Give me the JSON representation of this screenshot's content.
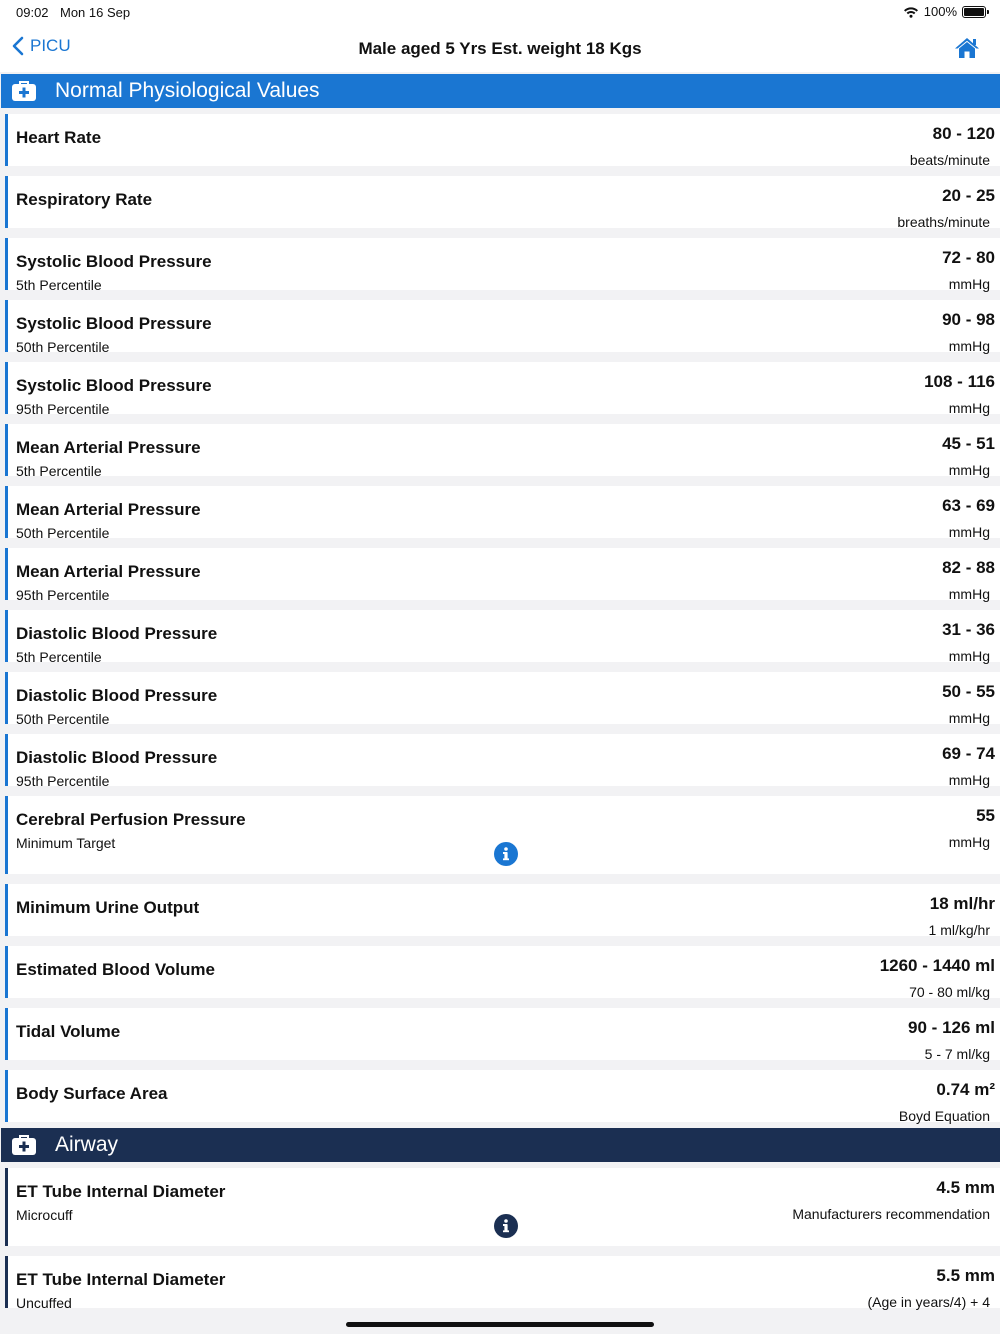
{
  "status": {
    "time": "09:02",
    "date": "Mon 16 Sep",
    "battery": "100%"
  },
  "nav": {
    "back_label": "PICU",
    "title": "Male aged 5 Yrs  Est. weight 18 Kgs"
  },
  "colors": {
    "accent": "#1a76d2",
    "airway_header": "#1b2f52"
  },
  "sections": [
    {
      "title": "Normal Physiological Values"
    },
    {
      "title": "Airway"
    }
  ],
  "rows": [
    {
      "name": "Heart Rate",
      "sub": "",
      "value": "80 - 120",
      "unit": "beats/minute"
    },
    {
      "name": "Respiratory Rate",
      "sub": "",
      "value": "20 - 25",
      "unit": "breaths/minute"
    },
    {
      "name": "Systolic Blood Pressure",
      "sub": "5th Percentile",
      "value": "72 - 80",
      "unit": "mmHg"
    },
    {
      "name": "Systolic Blood Pressure",
      "sub": "50th Percentile",
      "value": "90 - 98",
      "unit": "mmHg"
    },
    {
      "name": "Systolic Blood Pressure",
      "sub": "95th Percentile",
      "value": "108 - 116",
      "unit": "mmHg"
    },
    {
      "name": "Mean Arterial Pressure",
      "sub": "5th Percentile",
      "value": "45 - 51",
      "unit": "mmHg"
    },
    {
      "name": "Mean Arterial Pressure",
      "sub": "50th Percentile",
      "value": "63 - 69",
      "unit": "mmHg"
    },
    {
      "name": "Mean Arterial Pressure",
      "sub": "95th Percentile",
      "value": "82 - 88",
      "unit": "mmHg"
    },
    {
      "name": "Diastolic Blood Pressure",
      "sub": "5th Percentile",
      "value": "31 - 36",
      "unit": "mmHg"
    },
    {
      "name": "Diastolic Blood Pressure",
      "sub": "50th Percentile",
      "value": "50 - 55",
      "unit": "mmHg"
    },
    {
      "name": "Diastolic Blood Pressure",
      "sub": "95th Percentile",
      "value": "69 - 74",
      "unit": "mmHg"
    },
    {
      "name": "Cerebral Perfusion Pressure",
      "sub": "Minimum Target",
      "value": "55",
      "unit": "mmHg"
    },
    {
      "name": "Minimum Urine Output",
      "sub": "",
      "value": "18 ml/hr",
      "unit": "1 ml/kg/hr"
    },
    {
      "name": "Estimated Blood Volume",
      "sub": "",
      "value": "1260 - 1440 ml",
      "unit": "70 - 80 ml/kg"
    },
    {
      "name": "Tidal Volume",
      "sub": "",
      "value": "90 - 126 ml",
      "unit": "5 - 7 ml/kg"
    },
    {
      "name": "Body Surface Area",
      "sub": "",
      "value": "0.74 m²",
      "unit": "Boyd Equation"
    }
  ],
  "airway_rows": [
    {
      "name": "ET Tube Internal Diameter",
      "sub": "Microcuff",
      "value": "4.5 mm",
      "unit": "Manufacturers recommendation"
    },
    {
      "name": "ET Tube Internal Diameter",
      "sub": "Uncuffed",
      "value": "5.5 mm",
      "unit": "(Age in years/4) + 4"
    }
  ]
}
